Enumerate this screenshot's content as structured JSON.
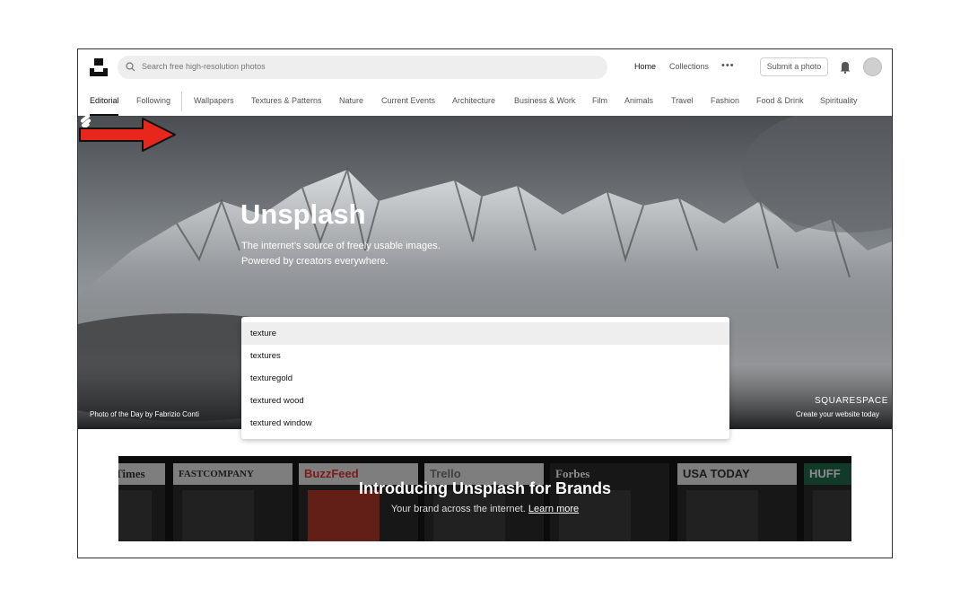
{
  "header": {
    "search_placeholder": "Search free high-resolution photos",
    "nav_home": "Home",
    "nav_collections": "Collections",
    "nav_more": "•••",
    "submit_button": "Submit a photo"
  },
  "categories": [
    {
      "label": "Editorial",
      "active": true
    },
    {
      "label": "Following"
    },
    {
      "label": "Wallpapers"
    },
    {
      "label": "Textures & Patterns"
    },
    {
      "label": "Nature"
    },
    {
      "label": "Current Events"
    },
    {
      "label": "Architecture"
    },
    {
      "label": "Business & Work"
    },
    {
      "label": "Film"
    },
    {
      "label": "Animals"
    },
    {
      "label": "Travel"
    },
    {
      "label": "Fashion"
    },
    {
      "label": "Food & Drink"
    },
    {
      "label": "Spirituality"
    }
  ],
  "hero": {
    "title": "Unsplash",
    "subtitle_line1": "The internet’s source of freely usable images.",
    "subtitle_line2": "Powered by creators everywhere.",
    "photo_credit": "Photo of the Day by Fabrizio Conti",
    "sponsor_name": "SQUARESPACE",
    "sponsor_tagline": "Create your website today"
  },
  "search": {
    "value": "texture",
    "suggestions": [
      "texture",
      "textures",
      "texturegold",
      "textured wood",
      "textured window"
    ]
  },
  "banner": {
    "title": "Introducing Unsplash for Brands",
    "subtitle": "Your brand across the internet.",
    "link": "Learn more",
    "publications": [
      "Times",
      "FASTCOMPANY",
      "BuzzFeed",
      "Trello",
      "Forbes",
      "USA TODAY",
      "HUFF"
    ]
  },
  "colors": {
    "annotation_arrow": "#e8261b",
    "hero_text": "#ffffff"
  }
}
